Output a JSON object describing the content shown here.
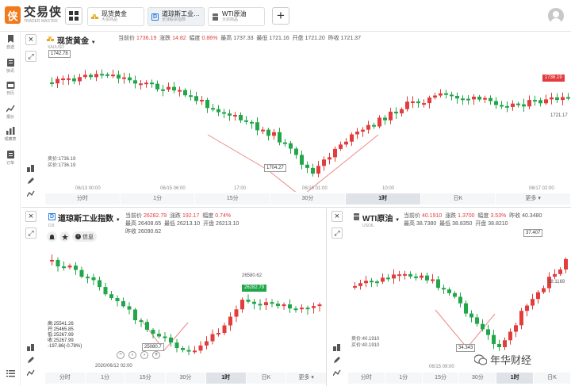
{
  "app": {
    "logo_cn": "交易侠",
    "logo_en": "TRADER MASTER"
  },
  "tabs": [
    {
      "title": "现货黄金",
      "sub": "大宗商品",
      "icon": "gold-bars-icon"
    },
    {
      "title": "道琼斯工业…",
      "sub": "全球股票指数",
      "icon": "index-d-icon"
    },
    {
      "title": "WTI原油",
      "sub": "大宗商品",
      "icon": "oil-barrel-icon"
    }
  ],
  "sidebar": [
    "自选",
    "快讯",
    "日历",
    "报价",
    "观察表",
    "订单"
  ],
  "gold": {
    "title": "现货黄金",
    "symbol": "XAUUSD",
    "q": {
      "cur_l": "当前价",
      "cur": "1736.19",
      "chg_l": "涨跌",
      "chg": "14.82",
      "pct_l": "幅度",
      "pct": "0.86%",
      "high_l": "最高",
      "high": "1737.33",
      "low_l": "最低",
      "low": "1721.16",
      "open_l": "开盘",
      "open": "1721.20",
      "prev_l": "昨收",
      "prev": "1721.37"
    },
    "labels": {
      "max": "1742.78",
      "min": "1704.27",
      "last": "1736.19",
      "ref": "1721.17",
      "sell": "卖价:1736.19",
      "buy": "买价:1736.19"
    },
    "dates": [
      "06/13 00:00",
      "06/15 06:00",
      "17:00",
      "06/16 01:00",
      "10:00",
      "06/17 02:00"
    ]
  },
  "dow": {
    "title": "道琼斯工业指数",
    "symbol": "DJI",
    "q1": {
      "cur_l": "当前价",
      "cur": "26282.79",
      "chg_l": "涨跌",
      "chg": "192.17",
      "pct_l": "幅度",
      "pct": "0.74%"
    },
    "q2": {
      "high_l": "最高",
      "high": "26408.65",
      "low_l": "最低",
      "low": "26213.10",
      "open_l": "开盘",
      "open": "26213.10"
    },
    "q3": {
      "prev_l": "昨收",
      "prev": "26090.62"
    },
    "info": "信息",
    "labels": {
      "ref": "26580.62",
      "last": "26282.79",
      "min": "25080.7",
      "date": "2020/06/12 02:00"
    },
    "ohlc": [
      "高:25541.26",
      "开:25465.85",
      "低:25267.99",
      "收:25267.99",
      "-197.86(-0.78%)"
    ]
  },
  "oil": {
    "title": "WTI原油",
    "symbol": "USOIL",
    "q1": {
      "cur_l": "当前价",
      "cur": "40.1910",
      "chg_l": "涨跌",
      "chg": "1.3700",
      "pct_l": "幅度",
      "pct": "3.53%",
      "prev_l": "昨收",
      "prev": "40.3480"
    },
    "q2": {
      "high_l": "最高",
      "high": "38.7380",
      "low_l": "最低",
      "low": "38.8350",
      "open_l": "开盘",
      "open": "38.8210"
    },
    "labels": {
      "max": "37.407",
      "mid": "38.1169",
      "min": "34.343",
      "sell": "卖价:40.1910",
      "buy": "买价:40.1910",
      "date": "06/15 09:00"
    }
  },
  "timeframes": {
    "full": [
      "分时",
      "1分",
      "15分",
      "30分",
      "1时",
      "日K",
      "更多"
    ],
    "active": "1时"
  },
  "watermark": "年华财经",
  "colors": {
    "up": "#e23c3c",
    "down": "#21a64a",
    "accent": "#f27a1a"
  }
}
